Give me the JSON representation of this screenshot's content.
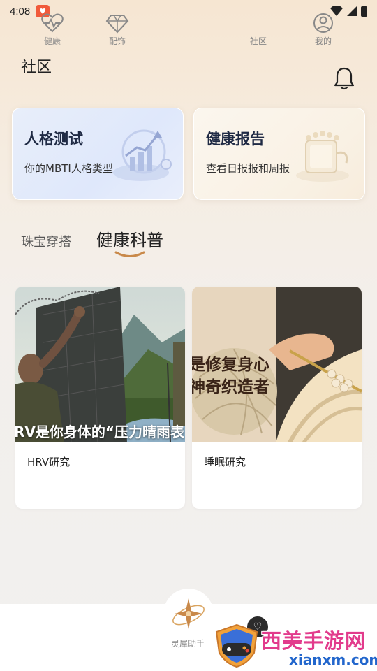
{
  "status_bar": {
    "time": "4:08"
  },
  "header": {
    "title": "社区"
  },
  "feature_cards": [
    {
      "title": "人格测试",
      "subtitle": "你的MBTI人格类型"
    },
    {
      "title": "健康报告",
      "subtitle": "查看日报报和周报"
    }
  ],
  "tabs": [
    {
      "label": "珠宝穿搭"
    },
    {
      "label": "健康科普",
      "active": true
    }
  ],
  "articles": [
    {
      "overlay": "RV是你身体的“压力晴雨表",
      "label": "HRV研究"
    },
    {
      "overlay_line1": "是修复身心",
      "overlay_line2": "神奇织造者",
      "label": "睡眠研究"
    }
  ],
  "bottom_nav": {
    "items": [
      {
        "label": "健康",
        "icon": "heart-pulse-icon"
      },
      {
        "label": "配饰",
        "icon": "diamond-icon"
      },
      {
        "label": "灵犀助手",
        "icon": "star-orbit-icon"
      },
      {
        "label": "社区",
        "icon": "heart-badge-icon"
      },
      {
        "label": "我的",
        "icon": "user-icon"
      }
    ]
  },
  "watermark": {
    "text": "西美手游网",
    "url": "xianxm.com"
  },
  "colors": {
    "accent": "#d9a35e",
    "tab_underline": "#c9894a",
    "card_title": "#1f2a44"
  }
}
